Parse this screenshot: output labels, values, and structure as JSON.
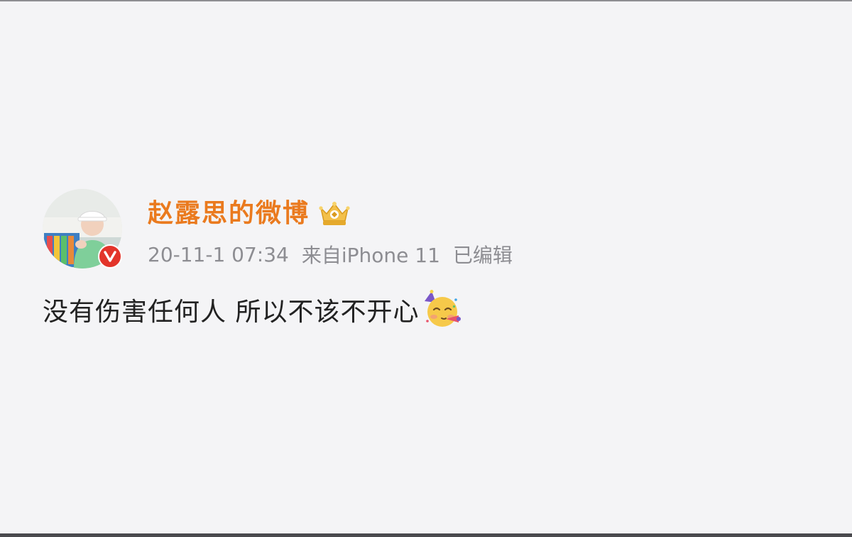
{
  "post": {
    "username": "赵露思的微博",
    "timestamp": "20-11-1 07:34",
    "source": "来自iPhone 11",
    "edited": "已编辑",
    "content": "没有伤害任何人 所以不该不开心"
  },
  "icons": {
    "user_badge": "crown-icon",
    "verified": "verified-v-icon",
    "emoji": "partying-face-icon"
  },
  "colors": {
    "username": "#ea7a1e",
    "meta": "#8d8d92",
    "content": "#222222",
    "verified": "#e3342a",
    "background": "#f4f4f6"
  }
}
